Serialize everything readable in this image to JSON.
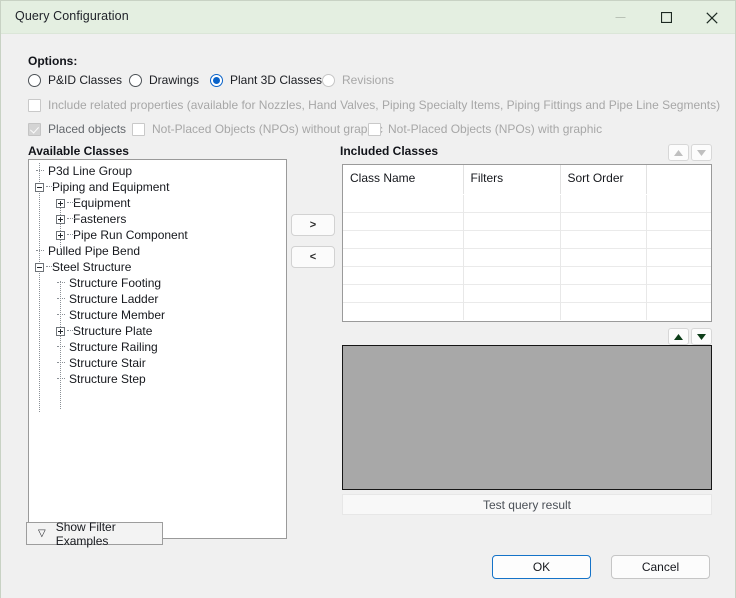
{
  "window": {
    "title": "Query Configuration",
    "controls": [
      {
        "name": "minimize-button",
        "glyph": "minimize",
        "enabled": false
      },
      {
        "name": "maximize-button",
        "glyph": "maximize",
        "enabled": true
      },
      {
        "name": "close-button",
        "glyph": "close",
        "enabled": true
      }
    ],
    "titlebar_color": "#e4efe1"
  },
  "options": {
    "label": "Options:",
    "radios": [
      {
        "label": "P&ID Classes",
        "checked": false,
        "disabled": false
      },
      {
        "label": "Drawings",
        "checked": false,
        "disabled": false
      },
      {
        "label": "Plant 3D Classes",
        "checked": true,
        "disabled": false
      },
      {
        "label": "Revisions",
        "checked": false,
        "disabled": true
      }
    ],
    "checkboxes": [
      {
        "label": "Include related properties (available for Nozzles, Hand Valves, Piping Specialty Items, Piping Fittings and Pipe Line Segments)",
        "checked": false,
        "disabled": true
      },
      {
        "label": "Placed objects",
        "checked": true,
        "disabled": true
      },
      {
        "label": "Not-Placed Objects (NPOs) without graphic",
        "checked": false,
        "disabled": true
      },
      {
        "label": "Not-Placed Objects (NPOs) with graphic",
        "checked": false,
        "disabled": true
      }
    ]
  },
  "available_classes": {
    "title": "Available Classes",
    "nodes": [
      {
        "label": "P3d Line Group",
        "depth": 0,
        "state": "leaf"
      },
      {
        "label": "Piping and Equipment",
        "depth": 0,
        "state": "expanded"
      },
      {
        "label": "Equipment",
        "depth": 1,
        "state": "collapsed"
      },
      {
        "label": "Fasteners",
        "depth": 1,
        "state": "collapsed"
      },
      {
        "label": "Pipe Run Component",
        "depth": 1,
        "state": "collapsed"
      },
      {
        "label": "Pulled Pipe Bend",
        "depth": 0,
        "state": "leaf"
      },
      {
        "label": "Steel Structure",
        "depth": 0,
        "state": "expanded"
      },
      {
        "label": "Structure Footing",
        "depth": 1,
        "state": "leaf"
      },
      {
        "label": "Structure Ladder",
        "depth": 1,
        "state": "leaf"
      },
      {
        "label": "Structure Member",
        "depth": 1,
        "state": "leaf"
      },
      {
        "label": "Structure Plate",
        "depth": 1,
        "state": "collapsed"
      },
      {
        "label": "Structure Railing",
        "depth": 1,
        "state": "leaf"
      },
      {
        "label": "Structure Stair",
        "depth": 1,
        "state": "leaf"
      },
      {
        "label": "Structure Step",
        "depth": 1,
        "state": "leaf"
      }
    ]
  },
  "transfer": {
    "add_label": ">",
    "remove_label": "<"
  },
  "included_classes": {
    "title": "Included Classes",
    "columns": [
      "Class Name",
      "Filters",
      "Sort Order",
      ""
    ],
    "rows": [],
    "empty_row_count": 7,
    "sort_up_enabled": false,
    "sort_down_enabled": false
  },
  "preview": {
    "move_up_enabled": true,
    "move_down_enabled": true,
    "test_button_label": "Test query result"
  },
  "footer": {
    "show_filter_examples_label": "Show Filter Examples",
    "ok_label": "OK",
    "cancel_label": "Cancel"
  }
}
